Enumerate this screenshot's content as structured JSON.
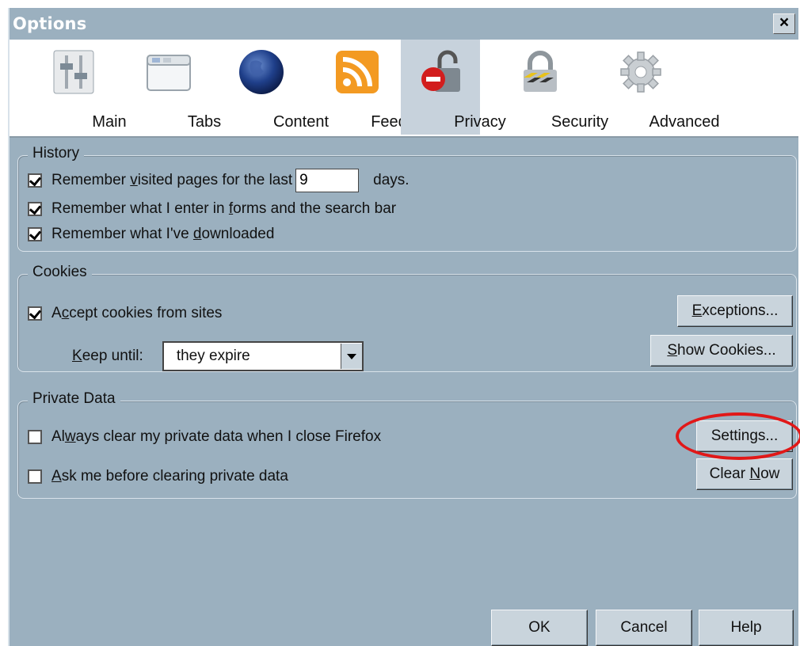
{
  "window": {
    "title": "Options",
    "close_label": "×"
  },
  "toolbar": {
    "items": [
      {
        "label": "Main",
        "icon": "main-icon"
      },
      {
        "label": "Tabs",
        "icon": "tabs-icon"
      },
      {
        "label": "Content",
        "icon": "globe-icon"
      },
      {
        "label": "Feeds",
        "icon": "rss-icon"
      },
      {
        "label": "Privacy",
        "icon": "privacy-lock-icon",
        "selected": true
      },
      {
        "label": "Security",
        "icon": "padlock-icon"
      },
      {
        "label": "Advanced",
        "icon": "gear-icon"
      }
    ]
  },
  "history": {
    "title": "History",
    "remember_pages_prefix": "Remember ",
    "remember_pages_u": "v",
    "remember_pages_suffix": "isited pages for the last",
    "days_value": "9",
    "days_label": "days.",
    "forms_prefix": "Remember what I enter in ",
    "forms_u": "f",
    "forms_suffix": "orms and the search bar",
    "downloads_prefix": "Remember what I've ",
    "downloads_u": "d",
    "downloads_suffix": "ownloaded"
  },
  "cookies": {
    "title": "Cookies",
    "accept_prefix": "A",
    "accept_u": "c",
    "accept_suffix": "cept cookies from sites",
    "keep_u": "K",
    "keep_suffix": "eep until:",
    "keep_value": "they expire",
    "exceptions_u": "E",
    "exceptions_suffix": "xceptions...",
    "show_u": "S",
    "show_suffix": "how Cookies..."
  },
  "private_data": {
    "title": "Private Data",
    "always_prefix": "Al",
    "always_u": "w",
    "always_suffix": "ays clear my private data when I close Firefox",
    "ask_u": "A",
    "ask_suffix": "sk me before clearing private data",
    "settings_label": "Settings...",
    "clear_prefix": "Clear ",
    "clear_u": "N",
    "clear_suffix": "ow"
  },
  "buttons": {
    "ok": "OK",
    "cancel": "Cancel",
    "help": "Help"
  },
  "colors": {
    "dialog_bg": "#9bb0bf",
    "highlight_ring": "#e11818"
  }
}
